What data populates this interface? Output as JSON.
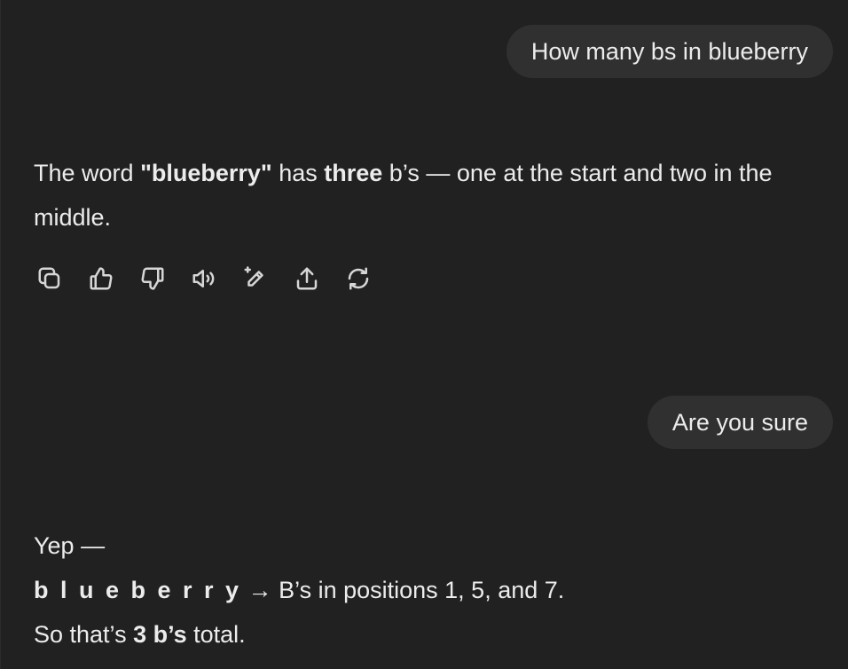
{
  "conversation": {
    "messages": [
      {
        "role": "user",
        "text": "How many bs in blueberry"
      },
      {
        "role": "assistant",
        "line1_pre": "The word ",
        "line1_word": "\"blueberry\"",
        "line1_mid": " has ",
        "line1_count": "three",
        "line1_post": " b’s — one at the start and two in the middle."
      },
      {
        "role": "user",
        "text": "Are you sure"
      },
      {
        "role": "assistant",
        "line1": "Yep —",
        "spelled": "b l u e b e r r y",
        "line2_post": " → B’s in positions 1, 5, and 7.",
        "line3_pre": "So that’s ",
        "line3_bold": "3 b’s",
        "line3_post": " total."
      }
    ]
  },
  "actions": {
    "icons": [
      "copy-icon",
      "thumbs-up-icon",
      "thumbs-down-icon",
      "read-aloud-icon",
      "edit-canvas-icon",
      "share-icon",
      "regenerate-icon"
    ]
  }
}
